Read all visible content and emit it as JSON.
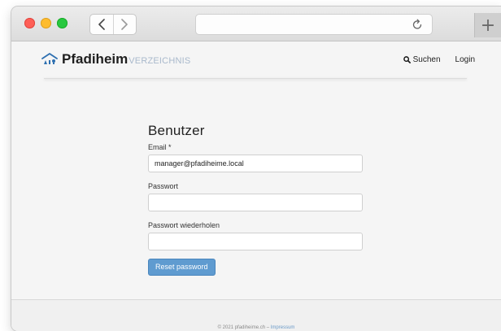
{
  "browser": {
    "new_tab_label": "+"
  },
  "site": {
    "brand_main": "Pfadiheim",
    "brand_sub": "VERZEICHNIS",
    "nav": {
      "search_label": "Suchen",
      "login_label": "Login"
    }
  },
  "form": {
    "title": "Benutzer",
    "email_label": "Email *",
    "email_value": "manager@pfadiheime.local",
    "password_label": "Passwort",
    "password_repeat_label": "Passwort wiederholen",
    "submit_label": "Reset password"
  },
  "footer": {
    "text": "© 2021 pfadiheime.ch – ",
    "link": "Impressum"
  },
  "colors": {
    "accent": "#5f9bd0",
    "brand_sub": "#a9b9cc",
    "close": "#fe5f57",
    "minimize": "#febc2e",
    "maximize": "#28c840"
  },
  "icons": [
    "back-arrow-icon",
    "forward-arrow-icon",
    "reload-icon",
    "house-logo-icon",
    "search-icon"
  ]
}
